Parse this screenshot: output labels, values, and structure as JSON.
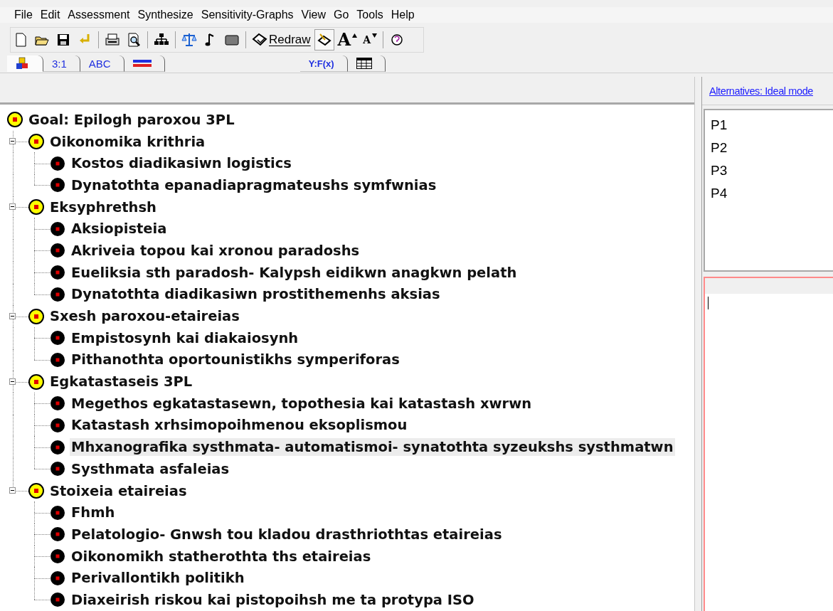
{
  "menu": [
    "File",
    "Edit",
    "Assessment",
    "Synthesize",
    "Sensitivity-Graphs",
    "View",
    "Go",
    "Tools",
    "Help"
  ],
  "toolbar": [
    {
      "kind": "new"
    },
    {
      "kind": "open"
    },
    {
      "kind": "save"
    },
    {
      "kind": "undo"
    },
    {
      "kind": "separator"
    },
    {
      "kind": "print"
    },
    {
      "kind": "preview"
    },
    {
      "kind": "separator"
    },
    {
      "kind": "hierarchy"
    },
    {
      "kind": "separator"
    },
    {
      "kind": "scales"
    },
    {
      "kind": "note"
    },
    {
      "kind": "panel"
    },
    {
      "kind": "separator"
    },
    {
      "kind": "redraw",
      "label": "Redraw"
    },
    {
      "kind": "pointer",
      "pressed": true
    },
    {
      "kind": "font-up",
      "label": "A"
    },
    {
      "kind": "font-down",
      "label": "A"
    },
    {
      "kind": "separator"
    },
    {
      "kind": "help"
    }
  ],
  "view_tabs": [
    {
      "kind": "cubes",
      "selected": true
    },
    {
      "kind": "text",
      "label": "3:1",
      "selected": false
    },
    {
      "kind": "text",
      "label": "ABC",
      "selected": false
    },
    {
      "kind": "flag",
      "selected": false
    }
  ],
  "output_tabs": [
    {
      "kind": "text",
      "label": "Y:F(x)",
      "selected": false
    },
    {
      "kind": "grid",
      "selected": false
    }
  ],
  "tree": {
    "label": "Goal: Epilogh paroxou 3PL",
    "kind": "goal",
    "selected": false,
    "children": [
      {
        "label": "Oikonomika krithria",
        "kind": "criterion",
        "selected": false,
        "expanded": true,
        "children": [
          {
            "label": "Kostos diadikasiwn logistics",
            "kind": "sub",
            "selected": false
          },
          {
            "label": "Dynatothta epanadiapragmateushs symfwnias",
            "kind": "sub",
            "selected": false
          }
        ]
      },
      {
        "label": "Eksyphrethsh",
        "kind": "criterion",
        "selected": false,
        "expanded": true,
        "children": [
          {
            "label": "Aksiopisteia",
            "kind": "sub",
            "selected": false
          },
          {
            "label": "Akriveia topou kai xronou paradoshs",
            "kind": "sub",
            "selected": false
          },
          {
            "label": "Eueliksia sth paradosh- Kalypsh eidikwn anagkwn pelath",
            "kind": "sub",
            "selected": false
          },
          {
            "label": "Dynatothta diadikasiwn prostithemenhs aksias",
            "kind": "sub",
            "selected": false
          }
        ]
      },
      {
        "label": "Sxesh paroxou-etaireias",
        "kind": "criterion",
        "selected": false,
        "expanded": true,
        "children": [
          {
            "label": "Empistosynh kai diakaiosynh",
            "kind": "sub",
            "selected": false
          },
          {
            "label": "Pithanothta oportounistikhs symperiforas",
            "kind": "sub",
            "selected": false
          }
        ]
      },
      {
        "label": "Egkatastaseis 3PL",
        "kind": "criterion",
        "selected": false,
        "expanded": true,
        "children": [
          {
            "label": "Megethos egkatastasewn, topothesia kai katastash xwrwn",
            "kind": "sub",
            "selected": false
          },
          {
            "label": "Katastash xrhsimopoihmenou eksoplismou",
            "kind": "sub",
            "selected": false
          },
          {
            "label": "Mhxanografika systhmata- automatismoi- synatothta syzeukshs systhmatwn",
            "kind": "sub",
            "selected": true
          },
          {
            "label": "Systhmata asfaleias",
            "kind": "sub",
            "selected": false
          }
        ]
      },
      {
        "label": "Stoixeia etaireias",
        "kind": "criterion",
        "selected": false,
        "expanded": true,
        "children": [
          {
            "label": "Fhmh",
            "kind": "sub",
            "selected": false
          },
          {
            "label": "Pelatologio- Gnwsh tou kladou drasthriothtas etaireias",
            "kind": "sub",
            "selected": false
          },
          {
            "label": "Oikonomikh statherothta ths etaireias",
            "kind": "sub",
            "selected": false
          },
          {
            "label": "Perivallontikh politikh",
            "kind": "sub",
            "selected": false
          },
          {
            "label": "Diaxeirish riskou kai pistopoihsh me ta protypa ISO",
            "kind": "sub",
            "selected": false
          }
        ]
      }
    ]
  },
  "alternatives": {
    "link": "Alternatives: Ideal mode",
    "items": [
      "P1",
      "P2",
      "P3",
      "P4"
    ]
  }
}
